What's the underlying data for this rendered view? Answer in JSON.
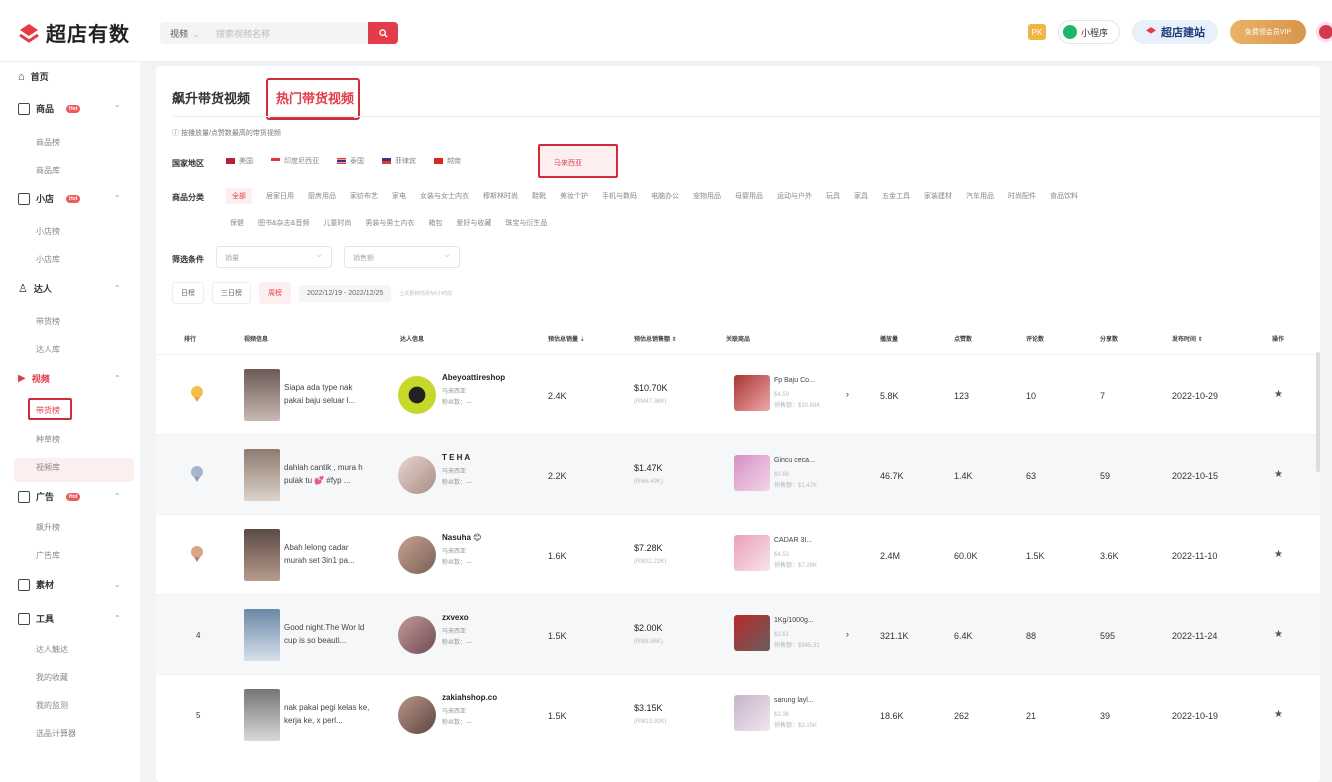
{
  "brand": {
    "name": "超店有数",
    "accent": "#e33b48"
  },
  "search": {
    "type": "视频",
    "placeholder": "搜索视频名称"
  },
  "topbar": {
    "pk": "PK",
    "mini": "小程序",
    "site": "超店建站",
    "vip": "免费领会员VIP"
  },
  "sidebar": {
    "home": "首页",
    "goods": "商品",
    "goods_badge": "Hot",
    "goods_subs": [
      "商品榜",
      "商品库"
    ],
    "shop": "小店",
    "shop_badge": "Hot",
    "shop_subs": [
      "小店榜",
      "小店库"
    ],
    "influencer": "达人",
    "influencer_subs": [
      "带货榜",
      "达人库"
    ],
    "video": "视频",
    "video_subs": [
      "带货榜",
      "种草榜",
      "视频库"
    ],
    "ads": "广告",
    "ads_badge": "Hot",
    "ads_subs": [
      "飙升榜",
      "广告库"
    ],
    "material": "素材",
    "tools": "工具",
    "tools_subs": [
      "达人触达",
      "我的收藏",
      "我的监测",
      "选品计算器"
    ]
  },
  "tabs": {
    "rising": "飙升带货视频",
    "hot": "热门带货视频"
  },
  "hint": "ⓘ 按播放量/点赞数最高的带货视频",
  "labels": {
    "country": "国家地区",
    "category": "商品分类",
    "filter": "筛选条件"
  },
  "countries": [
    "美国",
    "印度尼西亚",
    "泰国",
    "菲律宾",
    "越南",
    "马来西亚"
  ],
  "categories_row1": [
    "全部",
    "居家日用",
    "厨房用品",
    "家纺布艺",
    "家电",
    "女装与女士内衣",
    "穆斯林时尚",
    "鞋靴",
    "美妆个护",
    "手机与数码",
    "电脑办公",
    "宠物用品",
    "母婴用品",
    "运动与户外",
    "玩具",
    "家具",
    "五金工具",
    "家装建材",
    "汽车用品",
    "时尚配件",
    "食品饮料"
  ],
  "categories_row2": [
    "保健",
    "图书&杂志&音频",
    "儿童时尚",
    "男装与男士内衣",
    "箱包",
    "爱好与收藏",
    "珠宝与衍生品"
  ],
  "filters": {
    "f1": "销量",
    "f2": "销售额"
  },
  "period": {
    "day": "日榜",
    "three": "三日榜",
    "week": "周榜",
    "range": "2022/12/19 - 2022/12/25",
    "note": "上次更新时间为5小时前"
  },
  "columns": {
    "rank": "排行",
    "video": "视频信息",
    "influencer": "达人信息",
    "est_sales": "预估总销量 ⇣",
    "est_gmv": "预估总销售额 ⇕",
    "products": "关联商品",
    "plays": "播放量",
    "likes": "点赞数",
    "comments": "评论数",
    "shares": "分享数",
    "publish": "发布时间 ⇕",
    "action": "操作"
  },
  "rows": [
    {
      "rank": "1",
      "title": "Siapa ada type nak pakai baju seluar l...",
      "name": "Abeyoattireshop",
      "region": "马来西亚",
      "fans": "粉丝数：---",
      "sales": "2.4K",
      "gmv": "$10.70K",
      "gmv_local": "(RM47.36K)",
      "product": "Fp Baju Co...",
      "price": "$4.59",
      "psales": "销售额：$10.69K",
      "plays": "5.8K",
      "likes": "123",
      "comments": "10",
      "shares": "7",
      "date": "2022-10-29"
    },
    {
      "rank": "2",
      "title": "dahlah cantik , mura h pulak tu 💕 #fyp ...",
      "name": "T E H A",
      "region": "马来西亚",
      "fans": "粉丝数：---",
      "sales": "2.2K",
      "gmv": "$1.47K",
      "gmv_local": "(RM6.49K)",
      "product": "Gincu ceca...",
      "price": "$0.68",
      "psales": "销售额：$1.47K",
      "plays": "46.7K",
      "likes": "1.4K",
      "comments": "63",
      "shares": "59",
      "date": "2022-10-15"
    },
    {
      "rank": "3",
      "title": "Abah lelong cadar murah set 3in1 pa...",
      "name": "Nasuha 😊",
      "region": "马来西亚",
      "fans": "粉丝数：---",
      "sales": "1.6K",
      "gmv": "$7.28K",
      "gmv_local": "(RM32.22K)",
      "product": "CADAR 3I...",
      "price": "$4.52",
      "psales": "销售额：$7.28K",
      "plays": "2.4M",
      "likes": "60.0K",
      "comments": "1.5K",
      "shares": "3.6K",
      "date": "2022-11-10"
    },
    {
      "rank": "4",
      "title": "Good night.The Wor ld cup is so beauti...",
      "name": "zxvexo",
      "region": "马来西亚",
      "fans": "粉丝数：---",
      "sales": "1.5K",
      "gmv": "$2.00K",
      "gmv_local": "(RM8.86K)",
      "product": "1Kg/1000g...",
      "price": "$2.61",
      "psales": "销售额：$945.31",
      "plays": "321.1K",
      "likes": "6.4K",
      "comments": "88",
      "shares": "595",
      "date": "2022-11-24"
    },
    {
      "rank": "5",
      "title": "nak pakai pegi kelas ke, kerja ke, x perl...",
      "name": "zakiahshop.co",
      "region": "马来西亚",
      "fans": "粉丝数：---",
      "sales": "1.5K",
      "gmv": "$3.15K",
      "gmv_local": "(RM13.93K)",
      "product": "sarung layl...",
      "price": "$2.36",
      "psales": "销售额：$3.15K",
      "plays": "18.6K",
      "likes": "262",
      "comments": "21",
      "shares": "39",
      "date": "2022-10-19"
    }
  ]
}
